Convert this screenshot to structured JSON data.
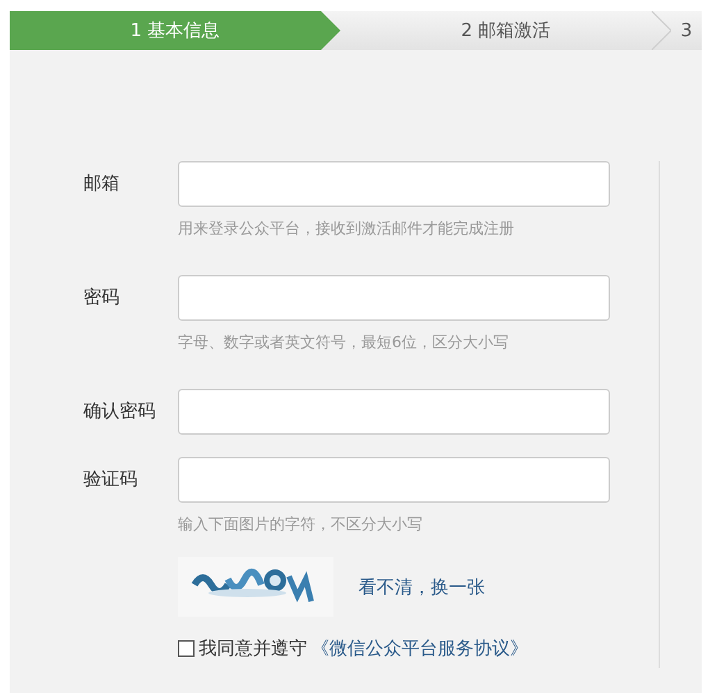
{
  "steps": [
    {
      "label": "1 基本信息",
      "selected": true
    },
    {
      "label": "2 邮箱激活",
      "selected": false
    },
    {
      "label": "3",
      "selected": false
    }
  ],
  "fields": [
    {
      "label": "邮箱",
      "hint": "用来登录公众平台，接收到激活邮件才能完成注册"
    },
    {
      "label": "密码",
      "hint": "字母、数字或者英文符号，最短6位，区分大小写"
    },
    {
      "label": "确认密码"
    },
    {
      "label": "验证码",
      "hint": "输入下面图片的字符，不区分大小写"
    }
  ],
  "captcha": {
    "kind": "picture",
    "refresh_link": "看不清，换一张"
  },
  "agreement": {
    "checked": false,
    "text": "我同意并遵守",
    "link": "《微信公众平台服务协议》"
  }
}
